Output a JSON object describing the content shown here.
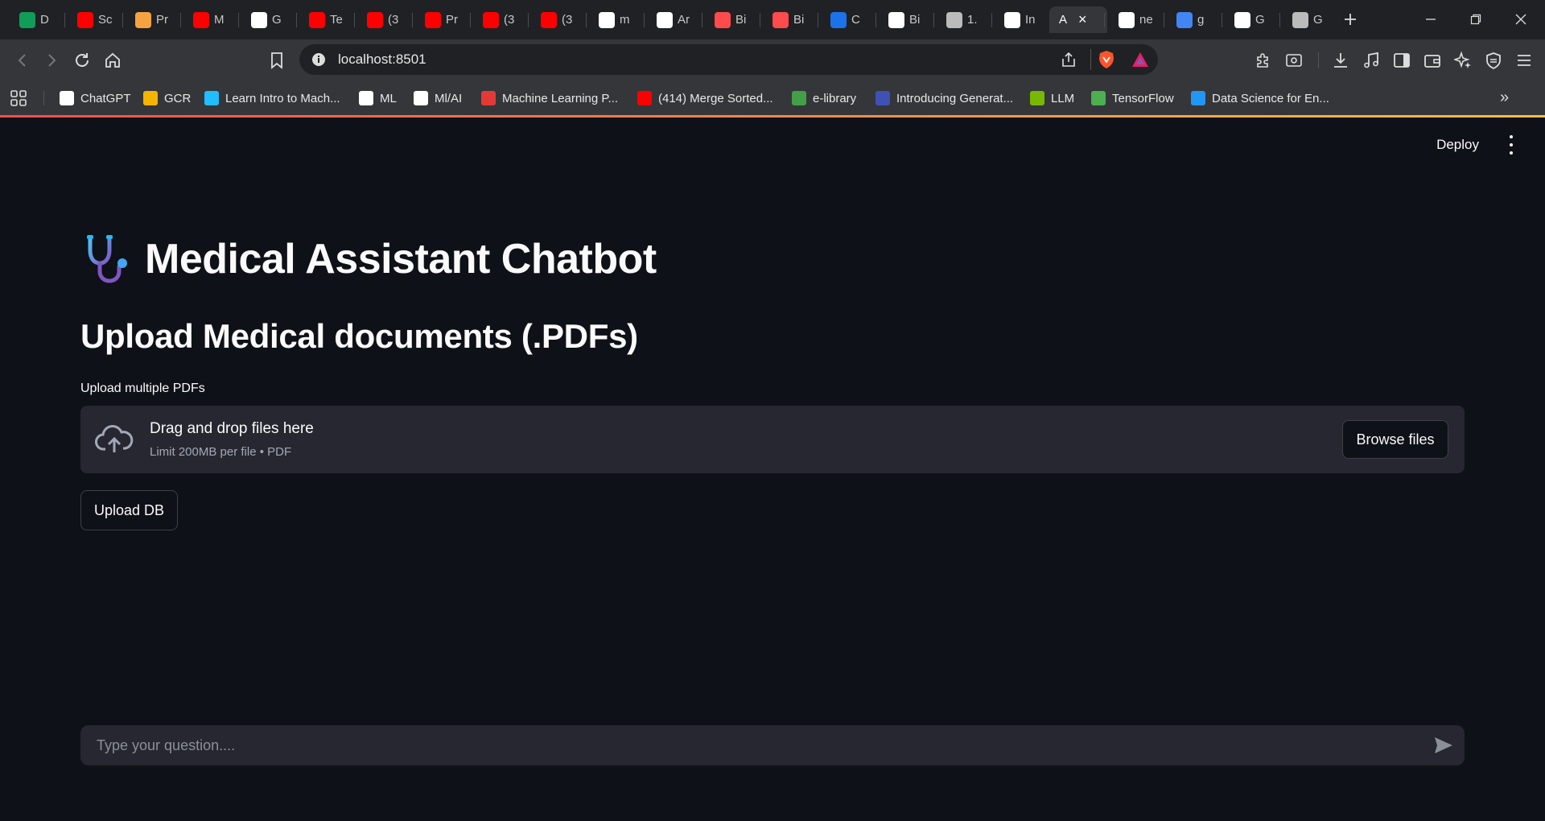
{
  "browser": {
    "tabs": [
      {
        "label": "D",
        "icon": "google-sheets-icon",
        "color": "#0f9d58"
      },
      {
        "label": "Sc",
        "icon": "youtube-icon",
        "color": "#ff0000"
      },
      {
        "label": "Pr",
        "icon": "person-icon",
        "color": "#f4a340"
      },
      {
        "label": "M",
        "icon": "youtube-icon",
        "color": "#ff0000"
      },
      {
        "label": "G",
        "icon": "github-icon",
        "color": "#ffffff"
      },
      {
        "label": "Te",
        "icon": "youtube-icon",
        "color": "#ff0000"
      },
      {
        "label": "(3",
        "icon": "youtube-icon",
        "color": "#ff0000"
      },
      {
        "label": "Pr",
        "icon": "youtube-icon",
        "color": "#ff0000"
      },
      {
        "label": "(3",
        "icon": "youtube-icon",
        "color": "#ff0000"
      },
      {
        "label": "(3",
        "icon": "youtube-icon",
        "color": "#ff0000"
      },
      {
        "label": "m",
        "icon": "github-icon",
        "color": "#ffffff"
      },
      {
        "label": "Ar",
        "icon": "app-icon",
        "color": "#ffffff"
      },
      {
        "label": "Bi",
        "icon": "streamlit-icon",
        "color": "#ff4b4b"
      },
      {
        "label": "Bi",
        "icon": "streamlit-icon",
        "color": "#ff4b4b"
      },
      {
        "label": "C",
        "icon": "c-icon",
        "color": "#1a73e8"
      },
      {
        "label": "Bi",
        "icon": "anthropic-icon",
        "color": "#ffffff"
      },
      {
        "label": "1.",
        "icon": "globe-icon",
        "color": "#bbbbbb"
      },
      {
        "label": "In",
        "icon": "openai-icon",
        "color": "#ffffff"
      },
      {
        "label": "A",
        "icon": "",
        "color": "#ffffff",
        "active": true
      },
      {
        "label": "ne",
        "icon": "github-icon",
        "color": "#ffffff"
      },
      {
        "label": "g",
        "icon": "google-icon",
        "color": "#4285f4"
      },
      {
        "label": "G",
        "icon": "openai-icon",
        "color": "#ffffff"
      },
      {
        "label": "G",
        "icon": "globe-icon",
        "color": "#bbbbbb"
      }
    ],
    "url": "localhost:8501",
    "bookmarks": [
      {
        "label": "ChatGPT",
        "icon": "openai-icon",
        "color": "#ffffff"
      },
      {
        "label": "GCR",
        "icon": "classroom-icon",
        "color": "#f4b400"
      },
      {
        "label": "Learn Intro to Mach...",
        "icon": "kaggle-icon",
        "color": "#20beff"
      },
      {
        "label": "ML",
        "icon": "edx-icon",
        "color": "#ffffff"
      },
      {
        "label": "Ml/AI",
        "icon": "edx-icon",
        "color": "#ffffff"
      },
      {
        "label": "Machine Learning P...",
        "icon": "bookmark-icon",
        "color": "#e53935"
      },
      {
        "label": "(414) Merge Sorted...",
        "icon": "youtube-icon",
        "color": "#ff0000"
      },
      {
        "label": "e-library",
        "icon": "library-icon",
        "color": "#43a047"
      },
      {
        "label": "Introducing Generat...",
        "icon": "u-icon",
        "color": "#3f51b5"
      },
      {
        "label": "LLM",
        "icon": "nvidia-icon",
        "color": "#76b900"
      },
      {
        "label": "TensorFlow",
        "icon": "tensorflow-icon",
        "color": "#4caf50"
      },
      {
        "label": "Data Science for En...",
        "icon": "s-icon",
        "color": "#2196f3"
      }
    ]
  },
  "app": {
    "deploy_label": "Deploy",
    "title": "Medical Assistant Chatbot",
    "subheader": "Upload Medical documents (.PDFs)",
    "uploader": {
      "label": "Upload multiple PDFs",
      "drop_title": "Drag and drop files here",
      "drop_subtitle": "Limit 200MB per file • PDF",
      "browse_label": "Browse files"
    },
    "upload_db_label": "Upload DB",
    "chat": {
      "placeholder": "Type your question...."
    }
  }
}
